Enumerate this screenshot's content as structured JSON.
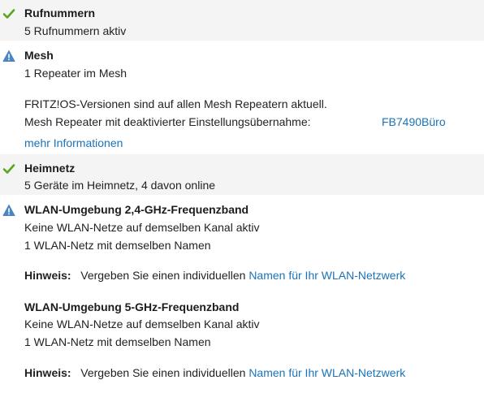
{
  "rufnummern": {
    "title": "Rufnummern",
    "status": "5 Rufnummern aktiv",
    "icon": "check-icon",
    "icon_color": "#5aa51e"
  },
  "mesh": {
    "title": "Mesh",
    "status": "1 Repeater im Mesh",
    "icon": "warning-icon",
    "icon_color": "#4a86c0",
    "versions_text": "FRITZ!OS-Versionen sind auf allen Mesh Repeatern aktuell.",
    "repeater_text": "Mesh Repeater mit deaktivierter Einstellungsübernahme:",
    "repeater_name": "FB7490Büro",
    "more_link": "mehr Informationen"
  },
  "heimnetz": {
    "title": "Heimnetz",
    "status": "5 Geräte im Heimnetz, 4 davon online",
    "icon": "check-icon",
    "icon_color": "#5aa51e"
  },
  "wlan24": {
    "title": "WLAN-Umgebung 2,4-GHz-Frequenzband",
    "line1": "Keine WLAN-Netze auf demselben Kanal aktiv",
    "line2": "1 WLAN-Netz mit demselben Namen",
    "hint_label": "Hinweis:",
    "hint_text": "Vergeben Sie einen individuellen",
    "hint_link": "Namen für Ihr WLAN-Netzwerk",
    "icon": "warning-icon",
    "icon_color": "#4a86c0"
  },
  "wlan5": {
    "title": "WLAN-Umgebung 5-GHz-Frequenzband",
    "line1": "Keine WLAN-Netze auf demselben Kanal aktiv",
    "line2": "1 WLAN-Netz mit demselben Namen",
    "hint_label": "Hinweis:",
    "hint_text": "Vergeben Sie einen individuellen",
    "hint_link": "Namen für Ihr WLAN-Netzwerk"
  }
}
